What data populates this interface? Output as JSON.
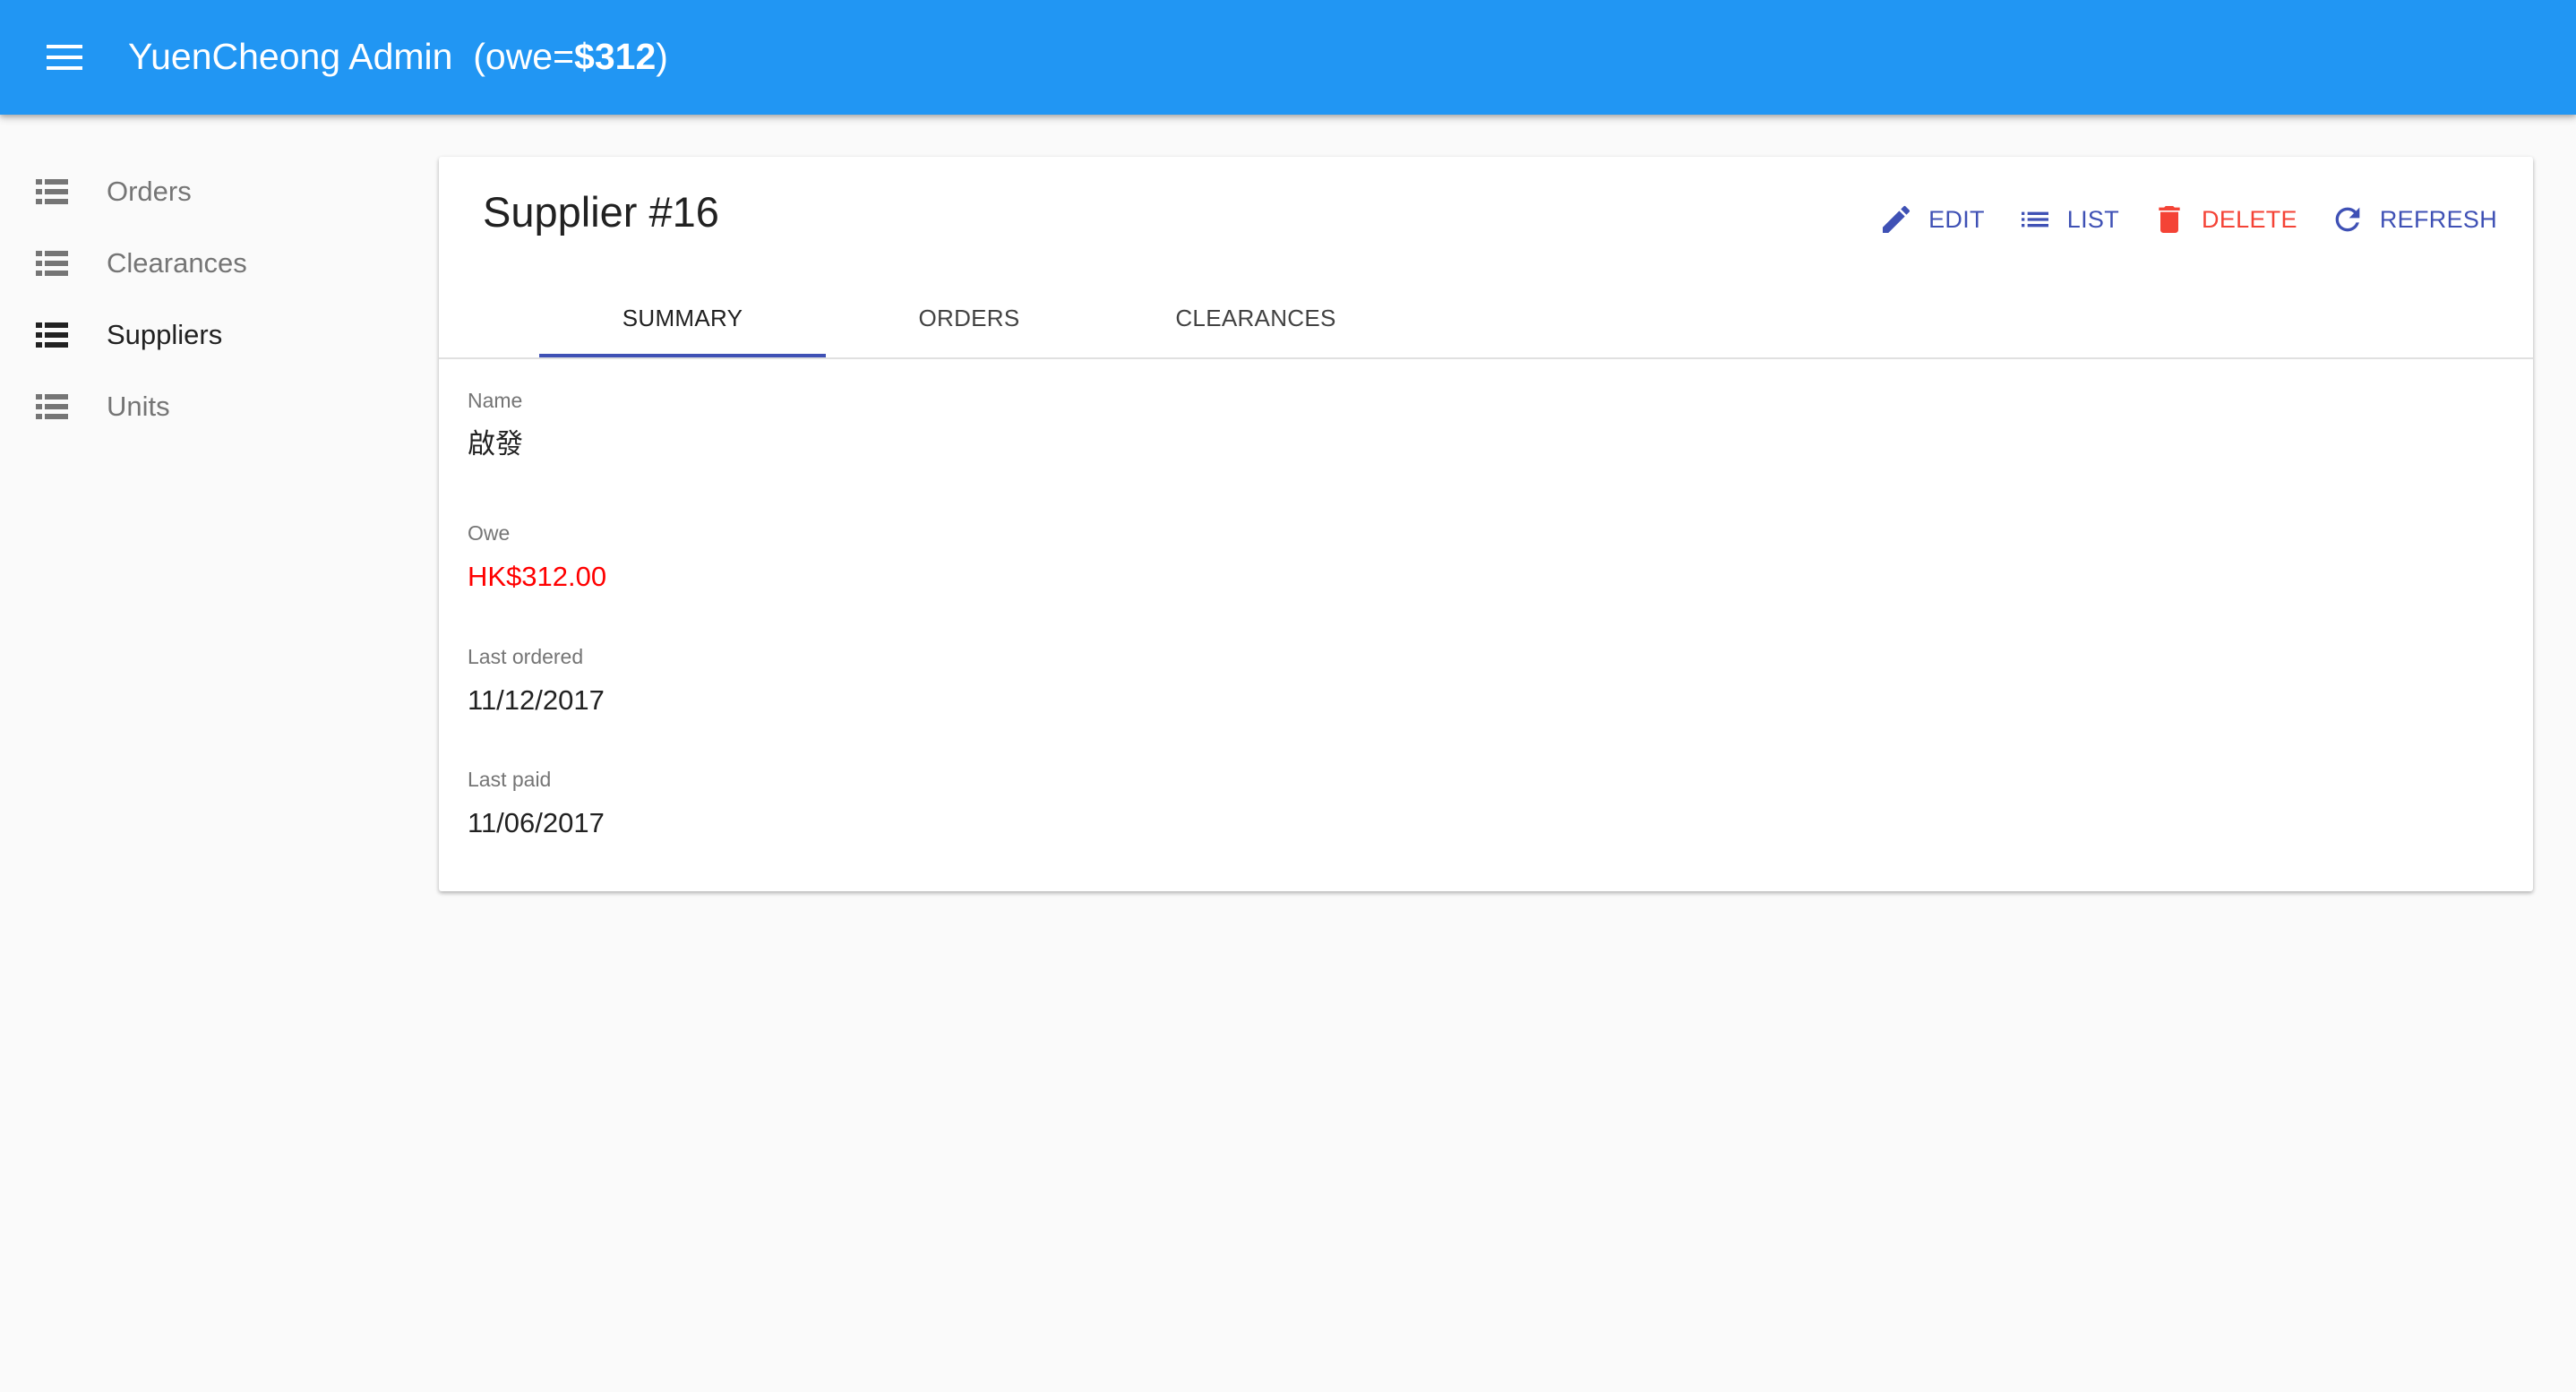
{
  "appbar": {
    "title_prefix": "YuenCheong Admin  (owe=",
    "title_amount": "$312",
    "title_suffix": ")",
    "menu_icon": "hamburger-menu-icon"
  },
  "sidebar": {
    "items": [
      {
        "label": "Orders",
        "icon": "list-icon",
        "active": false
      },
      {
        "label": "Clearances",
        "icon": "list-icon",
        "active": false
      },
      {
        "label": "Suppliers",
        "icon": "list-icon",
        "active": true
      },
      {
        "label": "Units",
        "icon": "list-icon",
        "active": false
      }
    ]
  },
  "card": {
    "title": "Supplier #16",
    "actions": {
      "edit": {
        "label": "EDIT",
        "icon": "pencil-icon"
      },
      "list": {
        "label": "LIST",
        "icon": "list-icon"
      },
      "delete": {
        "label": "DELETE",
        "icon": "trash-icon"
      },
      "refresh": {
        "label": "REFRESH",
        "icon": "refresh-icon"
      }
    },
    "tabs": [
      {
        "label": "SUMMARY",
        "active": true
      },
      {
        "label": "ORDERS",
        "active": false
      },
      {
        "label": "CLEARANCES",
        "active": false
      }
    ],
    "fields": {
      "name": {
        "label": "Name",
        "value": "啟發"
      },
      "owe": {
        "label": "Owe",
        "value": "HK$312.00"
      },
      "last_ordered": {
        "label": "Last ordered",
        "value": "11/12/2017"
      },
      "last_paid": {
        "label": "Last paid",
        "value": "11/06/2017"
      }
    }
  },
  "colors": {
    "appbar": "#2196f3",
    "primary": "#3f51b5",
    "danger": "#f44336",
    "owe_value": "#ff0000",
    "background": "#fafafa"
  }
}
